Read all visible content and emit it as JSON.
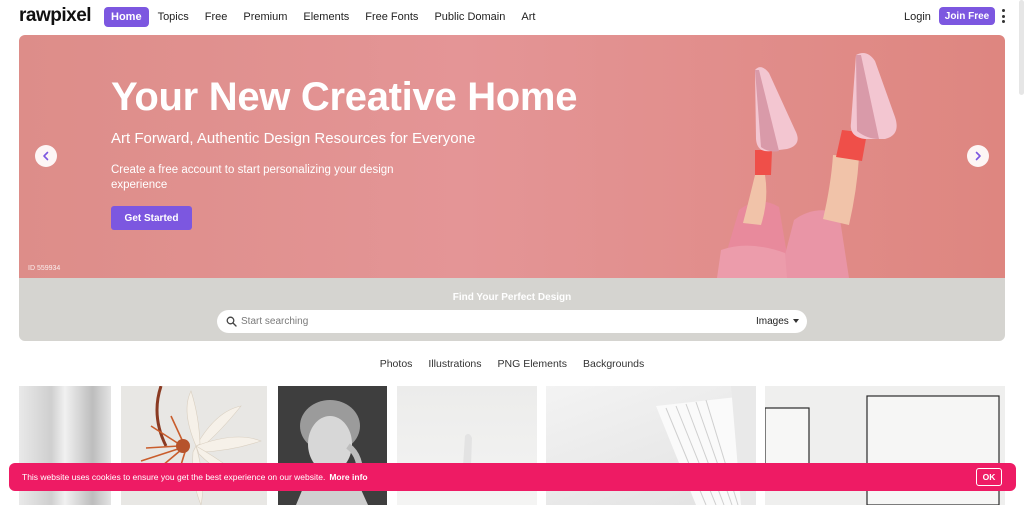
{
  "header": {
    "logo": "rawpixel",
    "nav": [
      {
        "label": "Home",
        "active": true
      },
      {
        "label": "Topics",
        "active": false
      },
      {
        "label": "Free",
        "active": false
      },
      {
        "label": "Premium",
        "active": false
      },
      {
        "label": "Elements",
        "active": false
      },
      {
        "label": "Free Fonts",
        "active": false
      },
      {
        "label": "Public Domain",
        "active": false
      },
      {
        "label": "Art",
        "active": false
      }
    ],
    "login_label": "Login",
    "join_label": "Join Free",
    "menu_icon": "more-vertical-icon"
  },
  "hero": {
    "title": "Your New Creative Home",
    "subtitle": "Art Forward, Authentic Design Resources for Everyone",
    "description": "Create a free account to start personalizing your design experience",
    "cta_label": "Get Started",
    "image_id": "ID 559934",
    "prev_icon": "chevron-left-icon",
    "next_icon": "chevron-right-icon"
  },
  "search": {
    "heading": "Find Your Perfect Design",
    "placeholder": "Start searching",
    "type_selected": "Images",
    "icon": "search-icon"
  },
  "categories": [
    "Photos",
    "Illustrations",
    "PNG Elements",
    "Backgrounds"
  ],
  "cookie": {
    "text": "This website uses cookies to ensure you get the best experience on our website.",
    "more_label": "More info",
    "ok_label": "OK"
  },
  "colors": {
    "accent": "#7c57e0",
    "hero_bg": "#e49596",
    "search_band": "#d5d4d0",
    "cookie_bg": "#ee1b64"
  }
}
